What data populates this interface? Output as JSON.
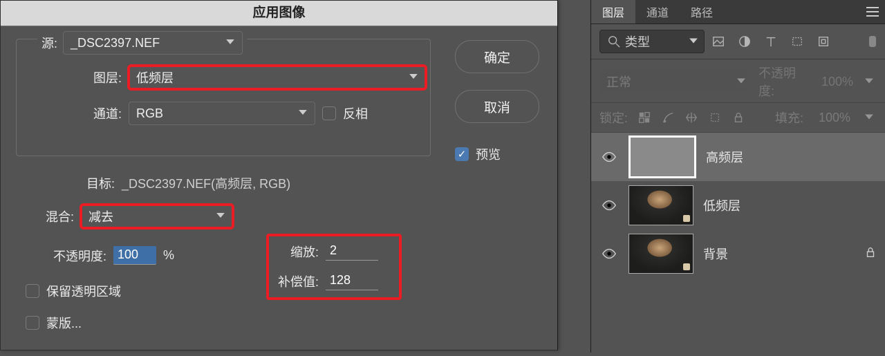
{
  "dialog": {
    "title": "应用图像",
    "source_label": "源:",
    "source_value": "_DSC2397.NEF",
    "layer_label": "图层:",
    "layer_value": "低频层",
    "channel_label": "通道:",
    "channel_value": "RGB",
    "invert_label": "反相",
    "target_label": "目标:",
    "target_value": "_DSC2397.NEF(高频层, RGB)",
    "blend_label": "混合:",
    "blend_value": "减去",
    "opacity_label": "不透明度:",
    "opacity_value": "100",
    "opacity_unit": "%",
    "scale_label": "缩放:",
    "scale_value": "2",
    "offset_label": "补偿值:",
    "offset_value": "128",
    "preserve_transparent_label": "保留透明区域",
    "mask_label": "蒙版...",
    "ok_label": "确定",
    "cancel_label": "取消",
    "preview_label": "预览"
  },
  "panel": {
    "tabs": {
      "layers": "图层",
      "channels": "通道",
      "paths": "路径"
    },
    "filter_label": "类型",
    "blend_mode": "正常",
    "opacity_label": "不透明度:",
    "opacity_value": "100%",
    "lock_label": "锁定:",
    "fill_label": "填充:",
    "fill_value": "100%",
    "layers": [
      {
        "name": "高频层",
        "selected": true,
        "gray": true,
        "locked": false
      },
      {
        "name": "低频层",
        "selected": false,
        "gray": false,
        "locked": false
      },
      {
        "name": "背景",
        "selected": false,
        "gray": false,
        "locked": true
      }
    ]
  },
  "icons": {
    "search": "search-icon",
    "image": "image-filter-icon",
    "adjust": "adjustment-filter-icon",
    "type": "type-filter-icon",
    "shape": "shape-filter-icon",
    "smart": "smart-filter-icon"
  }
}
